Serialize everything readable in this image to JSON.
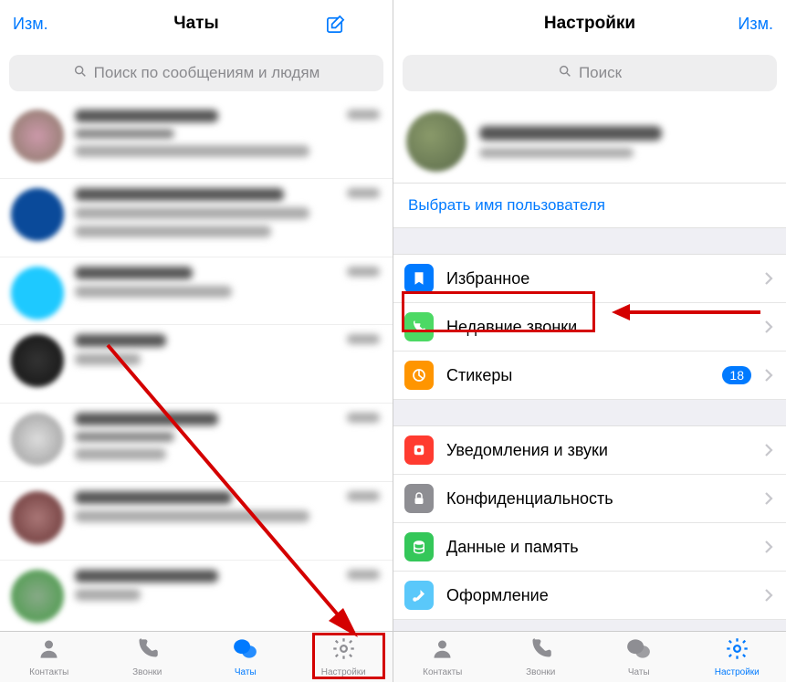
{
  "left": {
    "header": {
      "edit": "Изм.",
      "title": "Чаты"
    },
    "search_placeholder": "Поиск по сообщениям и людям",
    "tabs": {
      "contacts": "Контакты",
      "calls": "Звонки",
      "chats": "Чаты",
      "settings": "Настройки"
    }
  },
  "right": {
    "header": {
      "title": "Настройки",
      "edit": "Изм."
    },
    "search_placeholder": "Поиск",
    "username_link": "Выбрать имя пользователя",
    "cells": {
      "favorites": "Избранное",
      "recent_calls": "Недавние звонки",
      "stickers": "Стикеры",
      "stickers_badge": "18",
      "notifications": "Уведомления и звуки",
      "privacy": "Конфиденциальность",
      "data": "Данные и память",
      "appearance": "Оформление"
    },
    "tabs": {
      "contacts": "Контакты",
      "calls": "Звонки",
      "chats": "Чаты",
      "settings": "Настройки"
    }
  },
  "colors": {
    "blue": "#007aff",
    "fav": "#007aff",
    "calls": "#4cd964",
    "stickers": "#ff9500",
    "notif": "#ff3b30",
    "privacy": "#8e8e93",
    "data": "#34c759",
    "appearance": "#5ac8fa"
  }
}
